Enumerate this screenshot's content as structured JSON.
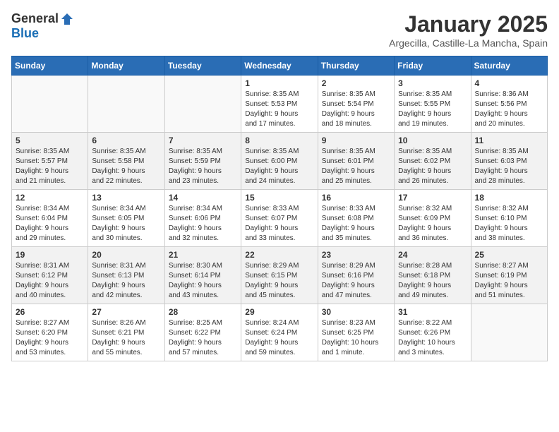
{
  "header": {
    "logo_general": "General",
    "logo_blue": "Blue",
    "title": "January 2025",
    "location": "Argecilla, Castille-La Mancha, Spain"
  },
  "weekdays": [
    "Sunday",
    "Monday",
    "Tuesday",
    "Wednesday",
    "Thursday",
    "Friday",
    "Saturday"
  ],
  "weeks": [
    [
      {
        "day": "",
        "info": ""
      },
      {
        "day": "",
        "info": ""
      },
      {
        "day": "",
        "info": ""
      },
      {
        "day": "1",
        "info": "Sunrise: 8:35 AM\nSunset: 5:53 PM\nDaylight: 9 hours\nand 17 minutes."
      },
      {
        "day": "2",
        "info": "Sunrise: 8:35 AM\nSunset: 5:54 PM\nDaylight: 9 hours\nand 18 minutes."
      },
      {
        "day": "3",
        "info": "Sunrise: 8:35 AM\nSunset: 5:55 PM\nDaylight: 9 hours\nand 19 minutes."
      },
      {
        "day": "4",
        "info": "Sunrise: 8:36 AM\nSunset: 5:56 PM\nDaylight: 9 hours\nand 20 minutes."
      }
    ],
    [
      {
        "day": "5",
        "info": "Sunrise: 8:35 AM\nSunset: 5:57 PM\nDaylight: 9 hours\nand 21 minutes."
      },
      {
        "day": "6",
        "info": "Sunrise: 8:35 AM\nSunset: 5:58 PM\nDaylight: 9 hours\nand 22 minutes."
      },
      {
        "day": "7",
        "info": "Sunrise: 8:35 AM\nSunset: 5:59 PM\nDaylight: 9 hours\nand 23 minutes."
      },
      {
        "day": "8",
        "info": "Sunrise: 8:35 AM\nSunset: 6:00 PM\nDaylight: 9 hours\nand 24 minutes."
      },
      {
        "day": "9",
        "info": "Sunrise: 8:35 AM\nSunset: 6:01 PM\nDaylight: 9 hours\nand 25 minutes."
      },
      {
        "day": "10",
        "info": "Sunrise: 8:35 AM\nSunset: 6:02 PM\nDaylight: 9 hours\nand 26 minutes."
      },
      {
        "day": "11",
        "info": "Sunrise: 8:35 AM\nSunset: 6:03 PM\nDaylight: 9 hours\nand 28 minutes."
      }
    ],
    [
      {
        "day": "12",
        "info": "Sunrise: 8:34 AM\nSunset: 6:04 PM\nDaylight: 9 hours\nand 29 minutes."
      },
      {
        "day": "13",
        "info": "Sunrise: 8:34 AM\nSunset: 6:05 PM\nDaylight: 9 hours\nand 30 minutes."
      },
      {
        "day": "14",
        "info": "Sunrise: 8:34 AM\nSunset: 6:06 PM\nDaylight: 9 hours\nand 32 minutes."
      },
      {
        "day": "15",
        "info": "Sunrise: 8:33 AM\nSunset: 6:07 PM\nDaylight: 9 hours\nand 33 minutes."
      },
      {
        "day": "16",
        "info": "Sunrise: 8:33 AM\nSunset: 6:08 PM\nDaylight: 9 hours\nand 35 minutes."
      },
      {
        "day": "17",
        "info": "Sunrise: 8:32 AM\nSunset: 6:09 PM\nDaylight: 9 hours\nand 36 minutes."
      },
      {
        "day": "18",
        "info": "Sunrise: 8:32 AM\nSunset: 6:10 PM\nDaylight: 9 hours\nand 38 minutes."
      }
    ],
    [
      {
        "day": "19",
        "info": "Sunrise: 8:31 AM\nSunset: 6:12 PM\nDaylight: 9 hours\nand 40 minutes."
      },
      {
        "day": "20",
        "info": "Sunrise: 8:31 AM\nSunset: 6:13 PM\nDaylight: 9 hours\nand 42 minutes."
      },
      {
        "day": "21",
        "info": "Sunrise: 8:30 AM\nSunset: 6:14 PM\nDaylight: 9 hours\nand 43 minutes."
      },
      {
        "day": "22",
        "info": "Sunrise: 8:29 AM\nSunset: 6:15 PM\nDaylight: 9 hours\nand 45 minutes."
      },
      {
        "day": "23",
        "info": "Sunrise: 8:29 AM\nSunset: 6:16 PM\nDaylight: 9 hours\nand 47 minutes."
      },
      {
        "day": "24",
        "info": "Sunrise: 8:28 AM\nSunset: 6:18 PM\nDaylight: 9 hours\nand 49 minutes."
      },
      {
        "day": "25",
        "info": "Sunrise: 8:27 AM\nSunset: 6:19 PM\nDaylight: 9 hours\nand 51 minutes."
      }
    ],
    [
      {
        "day": "26",
        "info": "Sunrise: 8:27 AM\nSunset: 6:20 PM\nDaylight: 9 hours\nand 53 minutes."
      },
      {
        "day": "27",
        "info": "Sunrise: 8:26 AM\nSunset: 6:21 PM\nDaylight: 9 hours\nand 55 minutes."
      },
      {
        "day": "28",
        "info": "Sunrise: 8:25 AM\nSunset: 6:22 PM\nDaylight: 9 hours\nand 57 minutes."
      },
      {
        "day": "29",
        "info": "Sunrise: 8:24 AM\nSunset: 6:24 PM\nDaylight: 9 hours\nand 59 minutes."
      },
      {
        "day": "30",
        "info": "Sunrise: 8:23 AM\nSunset: 6:25 PM\nDaylight: 10 hours\nand 1 minute."
      },
      {
        "day": "31",
        "info": "Sunrise: 8:22 AM\nSunset: 6:26 PM\nDaylight: 10 hours\nand 3 minutes."
      },
      {
        "day": "",
        "info": ""
      }
    ]
  ]
}
